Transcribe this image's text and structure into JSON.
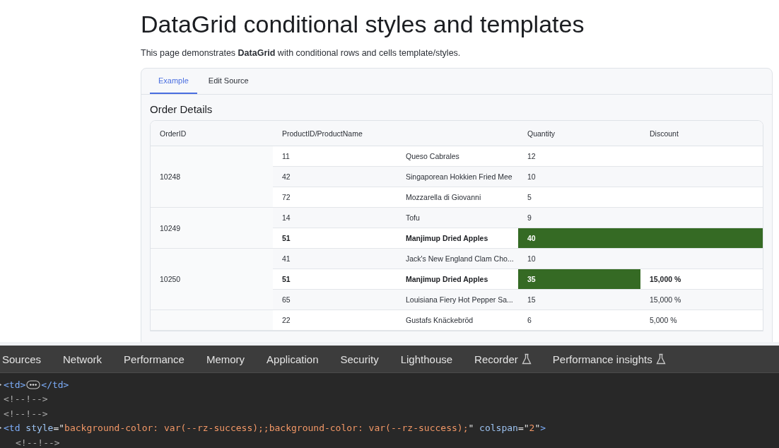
{
  "page": {
    "title": "DataGrid conditional styles and templates",
    "description": "This page demonstrates **DataGrid** with conditional rows and cells template/styles."
  },
  "tabs": [
    {
      "label": "Example",
      "selected": true
    },
    {
      "label": "Edit Source",
      "selected": false
    }
  ],
  "grid": {
    "title": "Order Details",
    "columns": [
      {
        "label": "OrderID",
        "kind": "single"
      },
      {
        "label": "ProductID/ProductName",
        "kind": "double"
      },
      {
        "label": "Quantity",
        "kind": "single"
      },
      {
        "label": "Discount",
        "kind": "single"
      }
    ],
    "orders": [
      {
        "order_id": "10248",
        "rows": [
          {
            "product_id": "11",
            "product_name": "Queso Cabrales",
            "quantity": "12",
            "highlighted": false,
            "success": false,
            "spans_discount": false
          },
          {
            "product_id": "42",
            "product_name": "Singaporean Hokkien Fried Mee",
            "quantity": "10",
            "highlighted": false,
            "success": false,
            "spans_discount": false
          },
          {
            "product_id": "72",
            "product_name": "Mozzarella di Giovanni",
            "quantity": "5",
            "highlighted": false,
            "success": false,
            "spans_discount": false
          }
        ]
      },
      {
        "order_id": "10249",
        "rows": [
          {
            "product_id": "14",
            "product_name": "Tofu",
            "quantity": "9",
            "highlighted": false,
            "success": false,
            "spans_discount": false
          },
          {
            "product_id": "51",
            "product_name": "Manjimup Dried Apples",
            "quantity": "40",
            "highlighted": true,
            "success": true,
            "spans_discount": true
          }
        ]
      },
      {
        "order_id": "10250",
        "rows": [
          {
            "product_id": "41",
            "product_name": "Jack's New England Clam Cho...",
            "quantity": "10",
            "highlighted": false,
            "success": false,
            "spans_discount": false
          },
          {
            "product_id": "51",
            "product_name": "Manjimup Dried Apples",
            "quantity": "35",
            "discount": "15,000 %",
            "highlighted": true,
            "success": true,
            "spans_discount": false
          },
          {
            "product_id": "65",
            "product_name": "Louisiana Fiery Hot Pepper Sa...",
            "quantity": "15",
            "discount": "15,000 %",
            "highlighted": false,
            "success": false,
            "spans_discount": false
          }
        ]
      },
      {
        "rows": [
          {
            "product_id": "22",
            "product_name": "Gustafs Knäckebröd",
            "quantity": "6",
            "discount": "5,000 %",
            "highlighted": false,
            "success": false,
            "spans_discount": false
          }
        ]
      }
    ]
  },
  "devtools": {
    "tabs": [
      {
        "label": "Sources",
        "experimental": false
      },
      {
        "label": "Network",
        "experimental": false
      },
      {
        "label": "Performance",
        "experimental": false
      },
      {
        "label": "Memory",
        "experimental": false
      },
      {
        "label": "Application",
        "experimental": false
      },
      {
        "label": "Security",
        "experimental": false
      },
      {
        "label": "Lighthouse",
        "experimental": false
      },
      {
        "label": "Recorder",
        "experimental": true
      },
      {
        "label": "Performance insights",
        "experimental": true
      }
    ],
    "lines": [
      {
        "expandable": true,
        "tokens": [
          {
            "kind": "tag",
            "text": "<td>"
          },
          {
            "kind": "ellipsis"
          },
          {
            "kind": "tag",
            "text": "</td>"
          }
        ]
      },
      {
        "expandable": false,
        "tokens": [
          {
            "kind": "comment",
            "text": "<!--!-->"
          }
        ]
      },
      {
        "expandable": false,
        "tokens": [
          {
            "kind": "comment",
            "text": "<!--!-->"
          }
        ]
      },
      {
        "expandable": true,
        "tokens": [
          {
            "kind": "tag",
            "text": "<td"
          },
          {
            "kind": "attr",
            "text": " style"
          },
          {
            "kind": "punct",
            "text": "=\""
          },
          {
            "kind": "value",
            "text": "background-color: var(--rz-success);;background-color: var(--rz-success);"
          },
          {
            "kind": "punct",
            "text": "\""
          },
          {
            "kind": "attr",
            "text": " colspan"
          },
          {
            "kind": "punct",
            "text": "=\""
          },
          {
            "kind": "value",
            "text": "2"
          },
          {
            "kind": "punct",
            "text": "\""
          },
          {
            "kind": "tag",
            "text": ">"
          }
        ],
        "children": [
          {
            "expandable": false,
            "tokens": [
              {
                "kind": "comment",
                "text": "<!--!-->"
              }
            ]
          }
        ]
      }
    ]
  }
}
